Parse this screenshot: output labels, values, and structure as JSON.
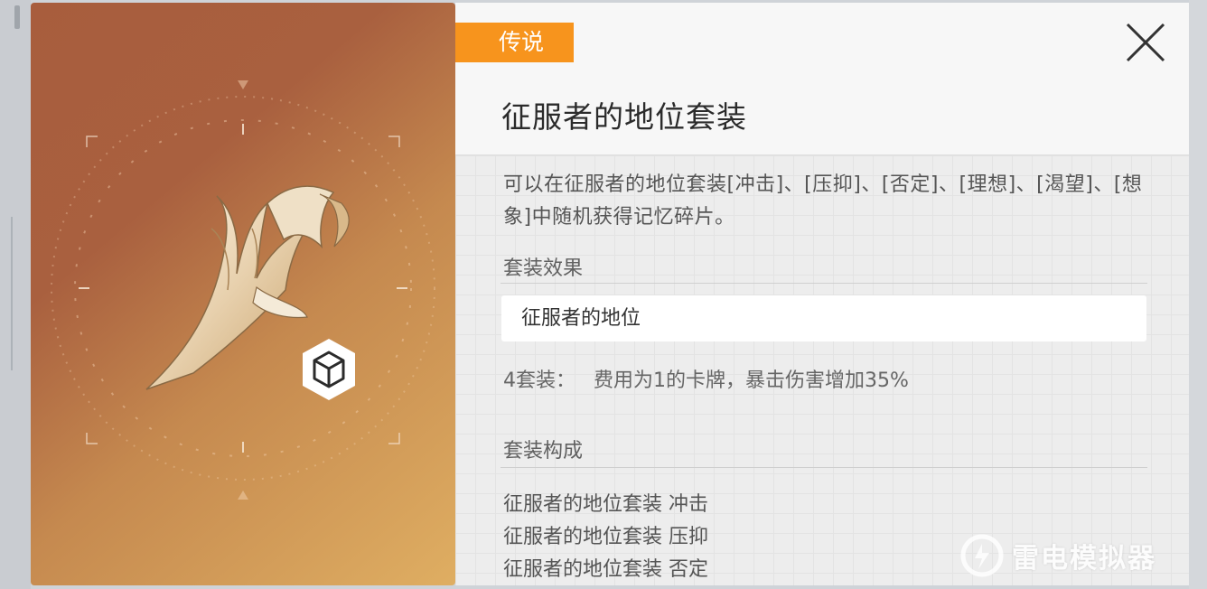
{
  "item": {
    "rarity": "传说",
    "title": "征服者的地位套装",
    "description": "可以在征服者的地位套装[冲击]、[压抑]、[否定]、[理想]、[渴望]、[想象]中随机获得记忆碎片。"
  },
  "set_effect": {
    "section_label": "套装效果",
    "set_name": "征服者的地位",
    "bonus_label": "4套装：",
    "bonus_text": "费用为1的卡牌，暴击伤害增加35%"
  },
  "composition": {
    "section_label": "套装构成",
    "items": [
      "征服者的地位套装 冲击",
      "征服者的地位套装 压抑",
      "征服者的地位套装 否定"
    ]
  },
  "watermark": {
    "text": "雷电模拟器"
  },
  "icons": {
    "close": "close-icon",
    "item_type": "cube-icon",
    "watermark_logo": "ldplayer-logo-icon"
  },
  "colors": {
    "rarity": "#f7941d",
    "art_top": "#a85d3d",
    "art_bottom": "#dfae62"
  }
}
